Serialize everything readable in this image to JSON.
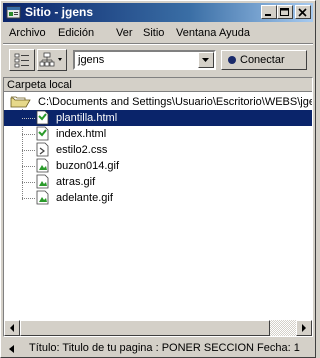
{
  "window": {
    "title": "Sitio - jgens"
  },
  "menu": {
    "items": [
      "Archivo",
      "Edición",
      "Ver",
      "Sitio",
      "Ventana",
      "Ayuda"
    ]
  },
  "toolbar": {
    "site_selected": "jgens",
    "connect_label": "Conectar"
  },
  "panel": {
    "header": "Carpeta local",
    "root_path": "C:\\Documents and Settings\\Usuario\\Escritorio\\WEBS\\jgens",
    "selected_file": "plantilla.html",
    "files": [
      {
        "name": "plantilla.html",
        "icon": "html-file-icon"
      },
      {
        "name": "index.html",
        "icon": "html-file-icon"
      },
      {
        "name": "estilo2.css",
        "icon": "css-file-icon"
      },
      {
        "name": "buzon014.gif",
        "icon": "gif-file-icon"
      },
      {
        "name": "atras.gif",
        "icon": "gif-file-icon"
      },
      {
        "name": "adelante.gif",
        "icon": "gif-file-icon"
      }
    ]
  },
  "statusbar": {
    "text": "Título: Titulo de tu pagina : PONER SECCION  Fecha: 1"
  },
  "colors": {
    "titlebar_start": "#0a246a",
    "titlebar_end": "#a6caf0",
    "selection": "#0a246a",
    "chrome": "#d4d0c8"
  }
}
